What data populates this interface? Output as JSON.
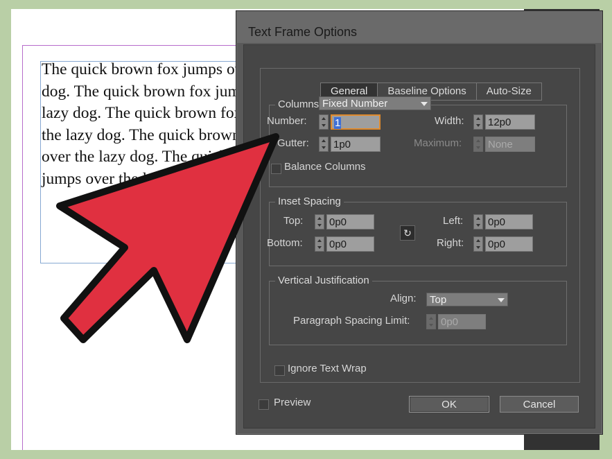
{
  "document": {
    "sample_text": "The quick brown fox jumps over the lazy dog. The quick brown fox jumps over the lazy dog. The quick brown fox jumps over the lazy dog. The quick brown fox jumps over the lazy dog. The quick brown fox jumps over the lazy"
  },
  "dialog": {
    "title": "Text Frame Options",
    "tabs": [
      {
        "label": "General",
        "active": true
      },
      {
        "label": "Baseline Options",
        "active": false
      },
      {
        "label": "Auto-Size",
        "active": false
      }
    ],
    "columns": {
      "legend": "Columns:",
      "mode": "Fixed Number",
      "number_label": "Number:",
      "number_value": "1",
      "width_label": "Width:",
      "width_value": "12p0",
      "gutter_label": "Gutter:",
      "gutter_value": "1p0",
      "maximum_label": "Maximum:",
      "maximum_value": "None",
      "balance_label": "Balance Columns"
    },
    "inset": {
      "legend": "Inset Spacing",
      "top_label": "Top:",
      "top_value": "0p0",
      "bottom_label": "Bottom:",
      "bottom_value": "0p0",
      "left_label": "Left:",
      "left_value": "0p0",
      "right_label": "Right:",
      "right_value": "0p0"
    },
    "vertical": {
      "legend": "Vertical Justification",
      "align_label": "Align:",
      "align_value": "Top",
      "para_label": "Paragraph Spacing Limit:",
      "para_value": "0p0"
    },
    "ignore_wrap_label": "Ignore Text Wrap",
    "preview_label": "Preview",
    "ok_label": "OK",
    "cancel_label": "Cancel"
  },
  "annotation": {
    "arrow_color": "#e03040"
  }
}
